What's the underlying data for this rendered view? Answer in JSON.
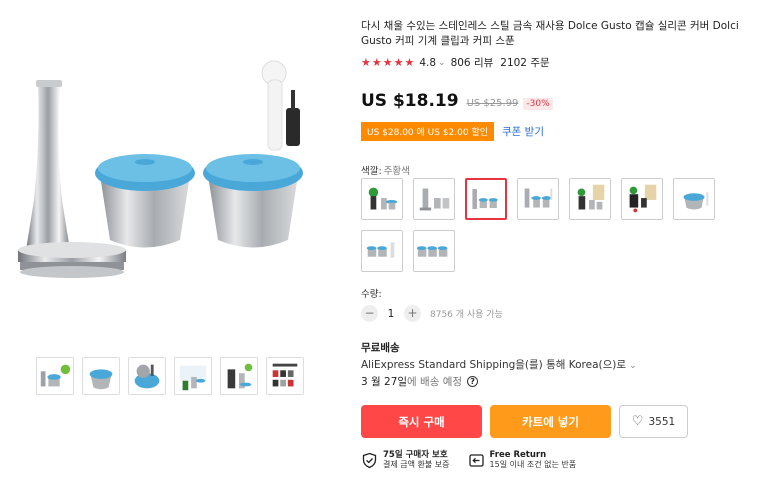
{
  "product": {
    "title": "다시 채울 수있는 스테인레스 스틸 금속 재사용 Dolce Gusto 캡슐 실리콘 커버 Dolci Gusto 커피 기계 클립과 커피 스푼",
    "rating": "4.8",
    "reviews": "806 리뷰",
    "orders": "2102 주문"
  },
  "price": {
    "current": "US $18.19",
    "original": "US $25.99",
    "discount": "-30%"
  },
  "coupon": {
    "badge": "US $28.00 에 US $2.00 할인",
    "link": "쿠폰 받기"
  },
  "color": {
    "label": "색깔:",
    "value": "주황색",
    "swatch_count": 9,
    "selected_index": 2
  },
  "quantity": {
    "label": "수량:",
    "minus": "−",
    "plus": "+",
    "value": "1",
    "stock": "8756 개 사용 가능"
  },
  "shipping": {
    "title": "무료배송",
    "via": "AliExpress Standard Shipping을(를) 통해 Korea(으)로",
    "date": "3 월 27일",
    "date_suffix": "에 배송 예정"
  },
  "actions": {
    "buy": "즉시 구매",
    "cart": "카트에 넣기",
    "wishlist": "3551"
  },
  "assurance": {
    "protection_title": "75일 구매자 보호",
    "protection_sub": "결제 금액 환불 보증",
    "return_title": "Free Return",
    "return_sub": "15일 이내 조건 없는 반품"
  },
  "icons": {
    "stars": "★★★★★",
    "chevron": "⌄",
    "heart": "♡",
    "help": "?"
  },
  "colors": {
    "accent_red": "#ff4747",
    "accent_orange": "#ff9a1a",
    "capsule_lid_blue": "#4aa8d8",
    "link_blue": "#2a6fdb"
  }
}
